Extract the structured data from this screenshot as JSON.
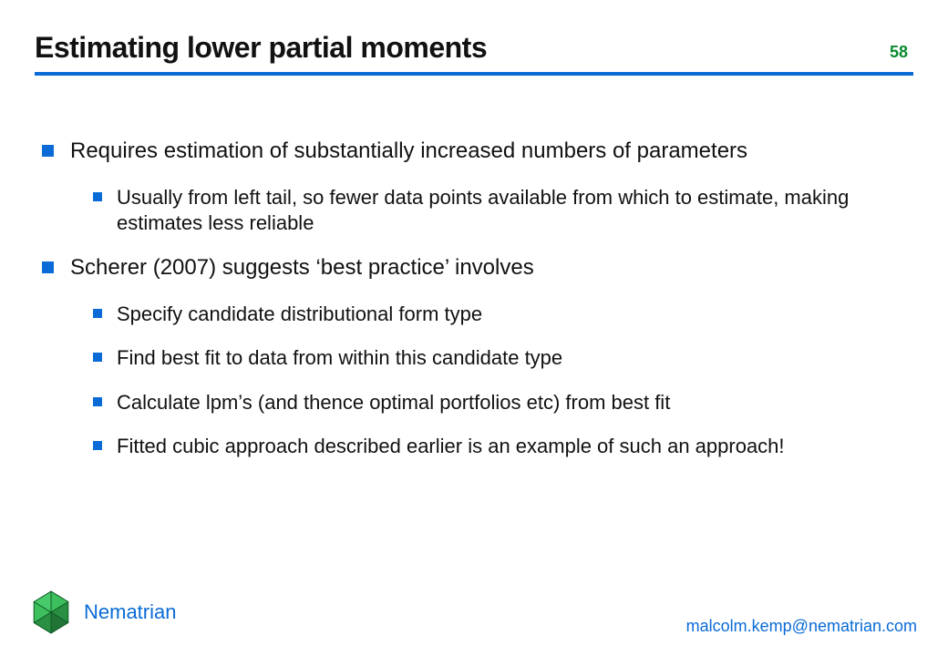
{
  "page": {
    "number": "58"
  },
  "title": "Estimating lower partial moments",
  "bullets": [
    {
      "text": "Requires estimation of substantially increased numbers of parameters",
      "children": [
        "Usually from left tail, so fewer data points available from which to estimate, making estimates less reliable"
      ]
    },
    {
      "text": "Scherer (2007) suggests ‘best practice’ involves",
      "children": [
        "Specify candidate distributional form type",
        "Find best fit to data from within this candidate type",
        "Calculate lpm’s (and thence optimal portfolios etc) from best fit",
        "Fitted cubic approach described earlier is an example of such an approach!"
      ]
    }
  ],
  "footer": {
    "brand": "Nematrian",
    "contact": "malcolm.kemp@nematrian.com"
  }
}
